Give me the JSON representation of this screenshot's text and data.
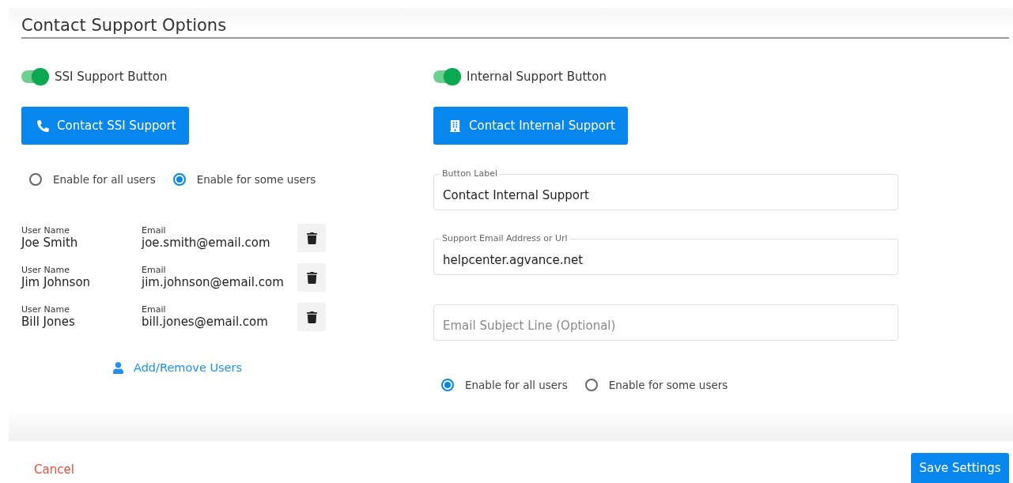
{
  "title": "Contact Support Options",
  "left_panel": {
    "toggle": {
      "label": "SSI Support Button",
      "on": true
    },
    "button": {
      "label": "Contact SSI Support"
    },
    "audience": [
      {
        "label": "Enable for all users",
        "selected": false
      },
      {
        "label": "Enable for some users",
        "selected": true
      }
    ],
    "users": [
      {
        "name_label": "User Name",
        "name": "Joe Smith",
        "email_label": "Email",
        "email": "joe.smith@email.com"
      },
      {
        "name_label": "User Name",
        "name": "Jim Johnson",
        "email_label": "Email",
        "email": "jim.johnson@email.com"
      },
      {
        "name_label": "User Name",
        "name": "Bill Jones",
        "email_label": "Email",
        "email": "bill.jones@email.com"
      }
    ],
    "link": "Add/Remove Users"
  },
  "right_panel": {
    "toggle": {
      "label": "Internal Support Button",
      "on": true
    },
    "button": {
      "label": "Contact Internal Support"
    },
    "fields": [
      {
        "label": "Button Label",
        "value": "Contact Internal Support"
      },
      {
        "label": "Support Email Address or Url",
        "value": "helpcenter.agvance.net"
      },
      {
        "placeholder": "Email Subject Line (Optional)"
      }
    ],
    "audience": [
      {
        "label": "Enable for all users",
        "selected": true
      },
      {
        "label": "Enable for some users",
        "selected": false
      }
    ]
  },
  "footer": {
    "cancel": "Cancel",
    "save": "Save Settings"
  }
}
